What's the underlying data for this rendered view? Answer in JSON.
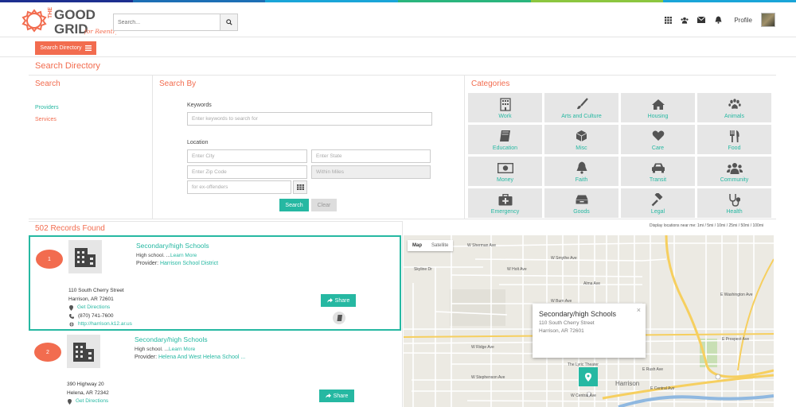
{
  "brand": {
    "line1": "THE",
    "line2": "GOOD",
    "line3": "GRID",
    "tagline": "for Reentry",
    "colors": {
      "orange": "#f26c4f",
      "teal": "#26b8a2",
      "grey": "#e6e6e6"
    }
  },
  "top_stripe_colors": [
    "#1d2f8f",
    "#1d6fb5",
    "#1aa5d8",
    "#2ab57d",
    "#8cc63f",
    "#1aa5d8"
  ],
  "header": {
    "search_placeholder": "Search...",
    "search_icon": "search-icon",
    "icons": [
      "apps-grid-icon",
      "users-icon",
      "envelope-icon",
      "bell-icon"
    ],
    "profile_label": "Profile"
  },
  "subbar": {
    "directory_button": "Search Directory"
  },
  "page_title": "Search Directory",
  "search_panel": {
    "title": "Search",
    "links": [
      "Providers",
      "Services"
    ]
  },
  "search_by": {
    "title": "Search By",
    "keywords_label": "Keywords",
    "keywords_placeholder": "Enter keywords to search for",
    "location_label": "Location",
    "city_placeholder": "Enter City",
    "state_placeholder": "Enter State",
    "zip_placeholder": "Enter Zip Code",
    "within_placeholder": "Within Miles",
    "tags_placeholder": "for ex-offenders",
    "search_button": "Search",
    "clear_button": "Clear"
  },
  "categories": {
    "title": "Categories",
    "items": [
      {
        "label": "Work",
        "icon": "building-icon"
      },
      {
        "label": "Arts and Culture",
        "icon": "paintbrush-icon"
      },
      {
        "label": "Housing",
        "icon": "home-icon"
      },
      {
        "label": "Animals",
        "icon": "paw-icon"
      },
      {
        "label": "Education",
        "icon": "book-icon"
      },
      {
        "label": "Misc",
        "icon": "cube-icon"
      },
      {
        "label": "Care",
        "icon": "heart-icon"
      },
      {
        "label": "Food",
        "icon": "cutlery-icon"
      },
      {
        "label": "Money",
        "icon": "money-icon"
      },
      {
        "label": "Faith",
        "icon": "bell-icon"
      },
      {
        "label": "Transit",
        "icon": "car-icon"
      },
      {
        "label": "Community",
        "icon": "users-icon"
      },
      {
        "label": "Emergency",
        "icon": "medkit-icon"
      },
      {
        "label": "Goods",
        "icon": "box-icon"
      },
      {
        "label": "Legal",
        "icon": "gavel-icon"
      },
      {
        "label": "Health",
        "icon": "stethoscope-icon"
      }
    ]
  },
  "records": {
    "count_label": "502 Records Found",
    "map_hint": "Display locations near me: 1mi / 5mi / 10mi / 25mi / 50mi / 100mi",
    "items": [
      {
        "number": "1",
        "title": "Secondary/high Schools",
        "desc": "High school. ...",
        "learn_more": "Learn More",
        "provider_label": "Provider:",
        "provider": "Harrison School District",
        "street": "110 South Cherry Street",
        "city": "Harrison, AR 72601",
        "directions": "Get Directions",
        "phone": "(870) 741-7600",
        "url": "http://harrison.k12.ar.us",
        "share": "Share"
      },
      {
        "number": "2",
        "title": "Secondary/high Schools",
        "desc": "High school. ...",
        "learn_more": "Learn More",
        "provider_label": "Provider:",
        "provider": "Helena And West Helena School ...",
        "street": "390 Highway 20",
        "city": "Helena, AR 72342",
        "directions": "Get Directions",
        "share": "Share"
      }
    ]
  },
  "map": {
    "tab_map": "Map",
    "tab_satellite": "Satellite",
    "popup_title": "Secondary/high Schools",
    "popup_street": "110 South Cherry Street",
    "popup_city": "Harrison, AR 72601",
    "popup_close": "×",
    "labels": {
      "sherman": "W Sherman Ave",
      "smythe": "W Smythe Ave",
      "holt": "W Holt Ave",
      "alma": "Alma Ave",
      "burn": "W Burn Ave",
      "skyline": "Skyline Dr",
      "ridge": "W Ridge Ave",
      "stephenson": "W Stephenson Ave",
      "central": "W Central Ave",
      "ecentral": "E Central Ave",
      "rush": "E Rush Ave",
      "prospect": "E Prospect Ave",
      "washington": "E Washington Ave",
      "harrison": "Harrison",
      "theater": "The Lyric Theater"
    }
  }
}
